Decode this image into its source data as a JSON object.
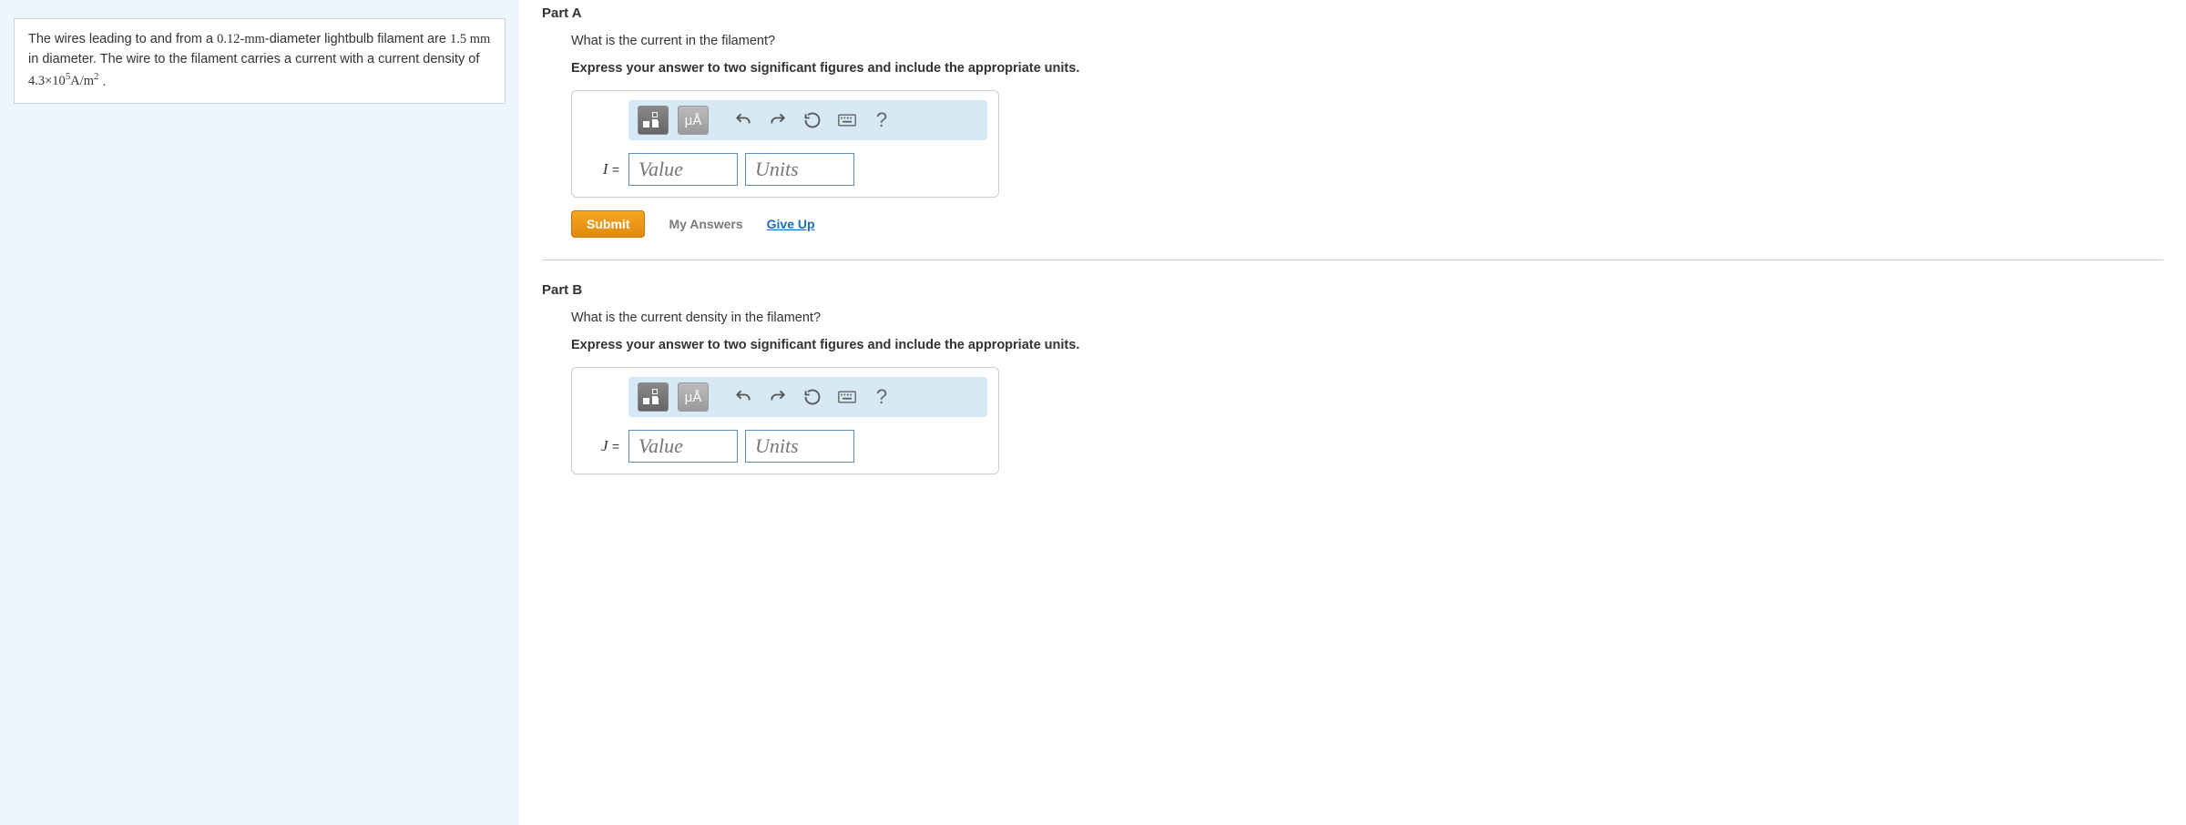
{
  "problem": {
    "text_pre": "The wires leading to and from a ",
    "d1": "0.12-mm",
    "text_mid1": "-diameter lightbulb filament are ",
    "d2": "1.5 mm",
    "text_mid2": " in diameter. The wire to the filament carries a current with a current density of ",
    "density_coeff": "4.3×10",
    "density_exp": "5",
    "density_units": "A/m",
    "density_units_exp": "2",
    "text_end": " ."
  },
  "parts": {
    "a": {
      "label": "Part A",
      "question": "What is the current in the filament?",
      "instruction": "Express your answer to two significant figures and include the appropriate units.",
      "var": "I",
      "value_placeholder": "Value",
      "units_placeholder": "Units"
    },
    "b": {
      "label": "Part B",
      "question": "What is the current density in the filament?",
      "instruction": "Express your answer to two significant figures and include the appropriate units.",
      "var": "J",
      "value_placeholder": "Value",
      "units_placeholder": "Units"
    }
  },
  "toolbar": {
    "units_btn": "μÅ",
    "help": "?"
  },
  "actions": {
    "submit": "Submit",
    "my_answers": "My Answers",
    "give_up": "Give Up"
  }
}
